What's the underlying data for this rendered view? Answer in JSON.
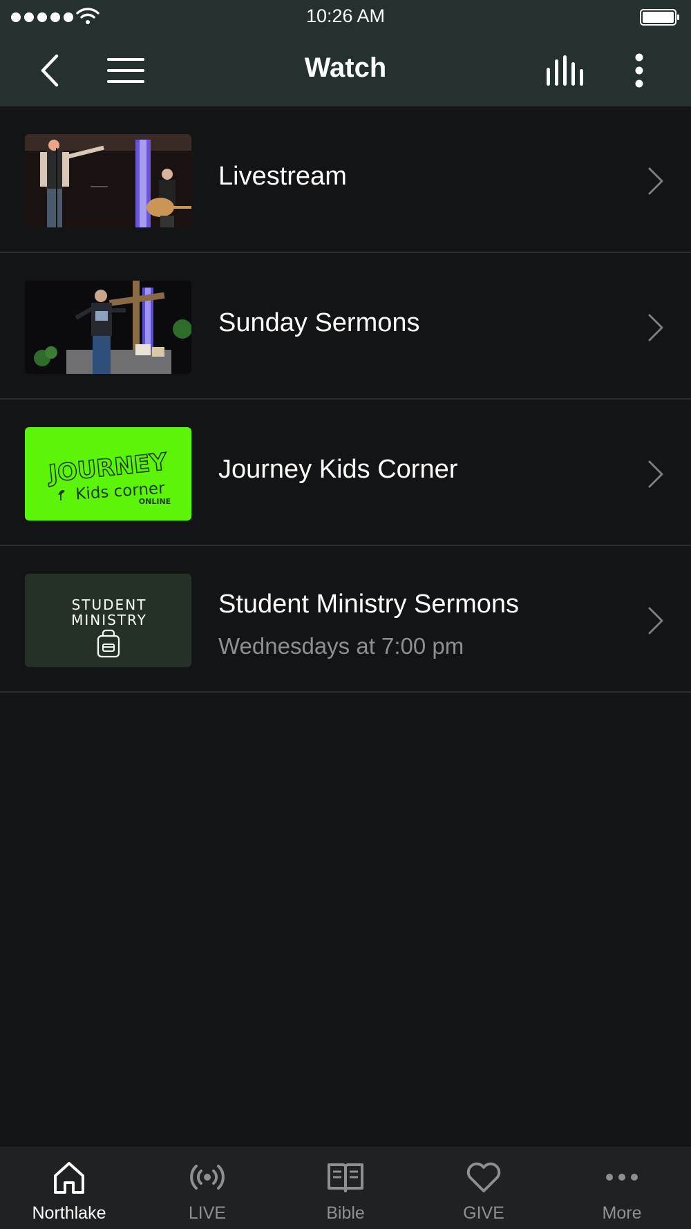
{
  "status_bar": {
    "time": "10:26 AM"
  },
  "nav": {
    "title": "Watch"
  },
  "items": [
    {
      "title": "Livestream",
      "subtitle": ""
    },
    {
      "title": "Sunday Sermons",
      "subtitle": ""
    },
    {
      "title": "Journey Kids Corner",
      "subtitle": ""
    },
    {
      "title": "Student Ministry Sermons",
      "subtitle": "Wednesdays at 7:00 pm"
    }
  ],
  "thumbnails": {
    "journey": {
      "word": "JOURNEY",
      "line": "Kids corner",
      "tag": "ONLINE"
    },
    "student": {
      "line1": "STUDENT",
      "line2": "MINISTRY"
    }
  },
  "tabs": [
    {
      "label": "Northlake",
      "icon": "home-icon",
      "active": true
    },
    {
      "label": "LIVE",
      "icon": "broadcast-icon",
      "active": false
    },
    {
      "label": "Bible",
      "icon": "book-icon",
      "active": false
    },
    {
      "label": "GIVE",
      "icon": "heart-icon",
      "active": false
    },
    {
      "label": "More",
      "icon": "more-dots-icon",
      "active": false
    }
  ],
  "colors": {
    "header": "#243130",
    "background": "#131415",
    "tabbar": "#202123",
    "accent_green": "#5cf50a",
    "student_bg": "#253126",
    "muted_text": "#8e8f92"
  }
}
